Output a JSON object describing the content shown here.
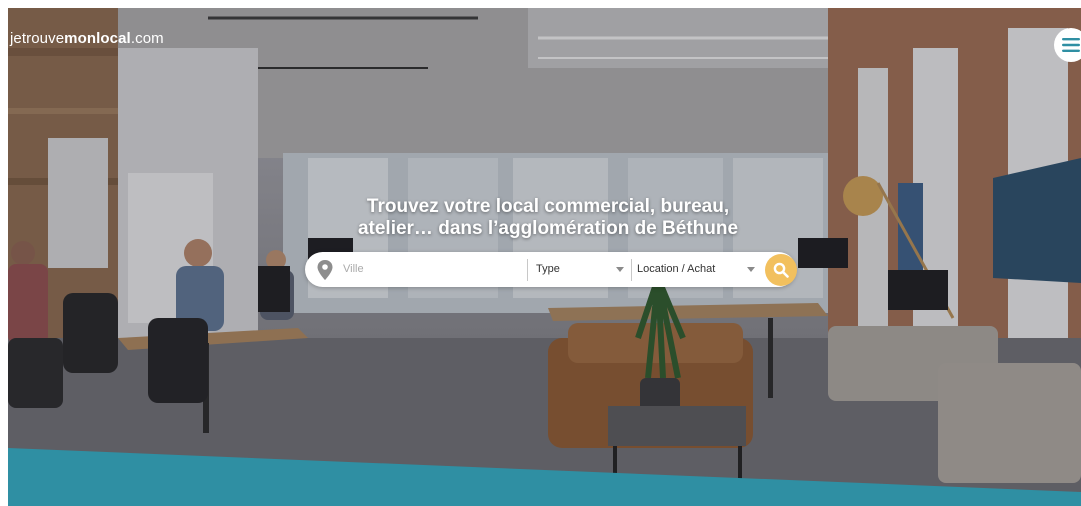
{
  "header": {
    "logo": {
      "part1": "jetrouve",
      "part2": "monlocal",
      "part3": ".com"
    },
    "menu_icon": "hamburger-menu-icon"
  },
  "hero": {
    "title_line1": "Trouvez votre local commercial, bureau,",
    "title_line2": "atelier… dans l’agglomération de Béthune"
  },
  "search": {
    "location_icon": "map-pin-icon",
    "ville_placeholder": "Ville",
    "type_value": "Type",
    "transaction_value": "Location / Achat",
    "search_icon": "magnifier-icon"
  },
  "colors": {
    "accent": "#f2c05e",
    "teal": "#2f8fa3",
    "text_light": "#ffffff"
  }
}
